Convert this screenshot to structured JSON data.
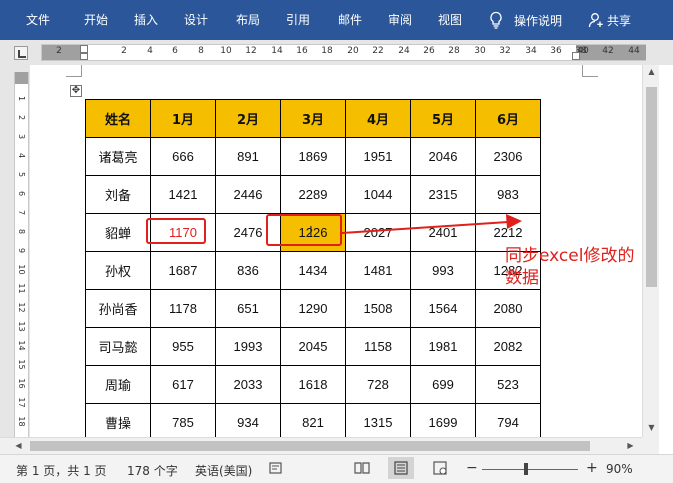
{
  "ribbon": {
    "tabs": [
      "文件",
      "开始",
      "插入",
      "设计",
      "布局",
      "引用",
      "邮件",
      "审阅",
      "视图"
    ],
    "search_label": "操作说明",
    "share_label": "共享"
  },
  "ruler": {
    "numbers": [
      "2",
      "2",
      "4",
      "6",
      "8",
      "10",
      "12",
      "14",
      "16",
      "18",
      "20",
      "22",
      "24",
      "26",
      "28",
      "30",
      "32",
      "34",
      "36",
      "38",
      "40",
      "42",
      "44"
    ],
    "vertical_numbers": [
      "1",
      "2",
      "3",
      "4",
      "5",
      "6",
      "7",
      "8",
      "9",
      "10",
      "11",
      "12",
      "13",
      "14",
      "15",
      "16",
      "17",
      "18"
    ]
  },
  "table": {
    "headers": [
      "姓名",
      "1月",
      "2月",
      "3月",
      "4月",
      "5月",
      "6月"
    ],
    "rows": [
      [
        "诸葛亮",
        "666",
        "891",
        "1869",
        "1951",
        "2046",
        "2306"
      ],
      [
        "刘备",
        "1421",
        "2446",
        "2289",
        "1044",
        "2315",
        "983"
      ],
      [
        "貂蝉",
        "1170",
        "2476",
        "1226",
        "2027",
        "2401",
        "2212"
      ],
      [
        "孙权",
        "1687",
        "836",
        "1434",
        "1481",
        "993",
        "1282"
      ],
      [
        "孙尚香",
        "1178",
        "651",
        "1290",
        "1508",
        "1564",
        "2080"
      ],
      [
        "司马懿",
        "955",
        "1993",
        "2045",
        "1158",
        "1981",
        "2082"
      ],
      [
        "周瑜",
        "617",
        "2033",
        "1618",
        "728",
        "699",
        "523"
      ],
      [
        "曹操",
        "785",
        "934",
        "821",
        "1315",
        "1699",
        "794"
      ]
    ]
  },
  "annotation": {
    "line1": "同步excel修改的",
    "line2": "数据",
    "color": "#e0201c"
  },
  "status_bar": {
    "page_info": "第 1 页，共 1 页",
    "word_count": "178 个字",
    "language": "英语(美国)",
    "zoom_minus": "−",
    "zoom_plus": "+",
    "zoom_level": "90%"
  },
  "colors": {
    "ribbon": "#2b579a",
    "header_fill": "#f5bf00",
    "highlight": "#e0201c"
  }
}
